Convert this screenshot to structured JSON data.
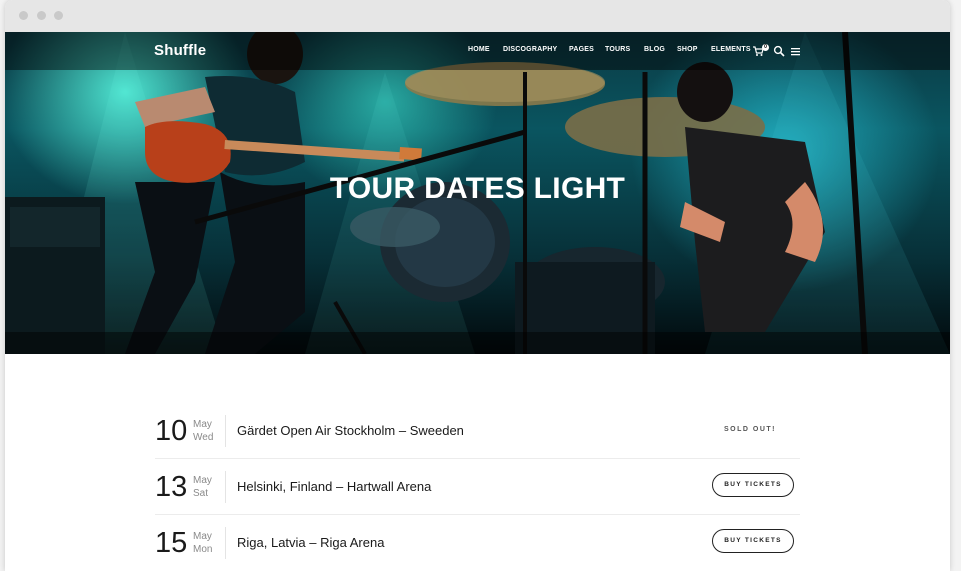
{
  "header": {
    "logo": "Shuffle",
    "nav": [
      "HOME",
      "DISCOGRAPHY",
      "PAGES",
      "TOURS",
      "BLOG",
      "SHOP",
      "ELEMENTS"
    ],
    "cart_count": "0",
    "icons": [
      "cart-icon",
      "search-icon",
      "menu-icon"
    ]
  },
  "hero": {
    "title": "TOUR DATES LIGHT"
  },
  "tours": [
    {
      "day": "10",
      "month": "May",
      "weekday": "Wed",
      "venue": "Gärdet Open Air Stockholm – Sweeden",
      "status": "SOLD OUT!",
      "action": null
    },
    {
      "day": "13",
      "month": "May",
      "weekday": "Sat",
      "venue": "Helsinki, Finland – Hartwall Arena",
      "status": null,
      "action": "BUY TICKETS"
    },
    {
      "day": "15",
      "month": "May",
      "weekday": "Mon",
      "venue": "Riga, Latvia – Riga Arena",
      "status": null,
      "action": "BUY TICKETS"
    }
  ]
}
